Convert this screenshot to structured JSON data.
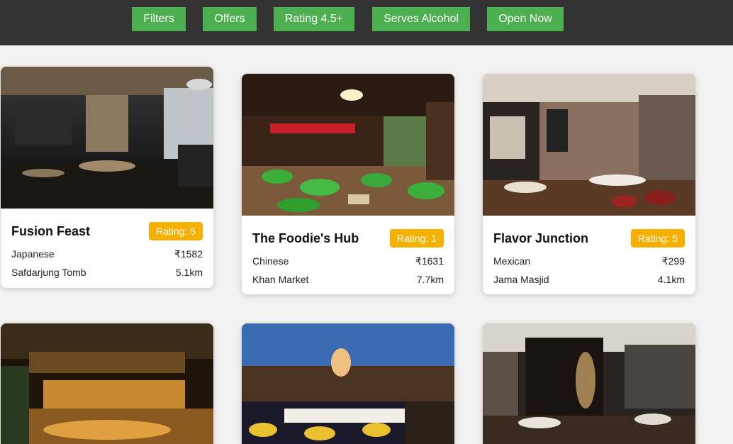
{
  "filters": [
    {
      "label": "Filters"
    },
    {
      "label": "Offers"
    },
    {
      "label": "Rating 4.5+"
    },
    {
      "label": "Serves Alcohol"
    },
    {
      "label": "Open Now"
    }
  ],
  "colors": {
    "topbar": "#333333",
    "filter_button": "#4caf50",
    "rating_badge": "#f6b000",
    "page_background": "#f2f2f2"
  },
  "restaurants": [
    {
      "name": "Fusion Feast",
      "rating": "Rating: 5",
      "cuisine": "Japanese",
      "price": "₹1582",
      "location": "Safdarjung Tomb",
      "distance": "5.1km"
    },
    {
      "name": "The Foodie's Hub",
      "rating": "Rating: 1",
      "cuisine": "Chinese",
      "price": "₹1631",
      "location": "Khan Market",
      "distance": "7.7km"
    },
    {
      "name": "Flavor Junction",
      "rating": "Rating: 5",
      "cuisine": "Mexican",
      "price": "₹299",
      "location": "Jama Masjid",
      "distance": "4.1km"
    },
    {
      "name": "",
      "rating": "",
      "cuisine": "",
      "price": "",
      "location": "",
      "distance": ""
    },
    {
      "name": "",
      "rating": "",
      "cuisine": "",
      "price": "",
      "location": "",
      "distance": ""
    },
    {
      "name": "",
      "rating": "",
      "cuisine": "",
      "price": "",
      "location": "",
      "distance": ""
    }
  ]
}
